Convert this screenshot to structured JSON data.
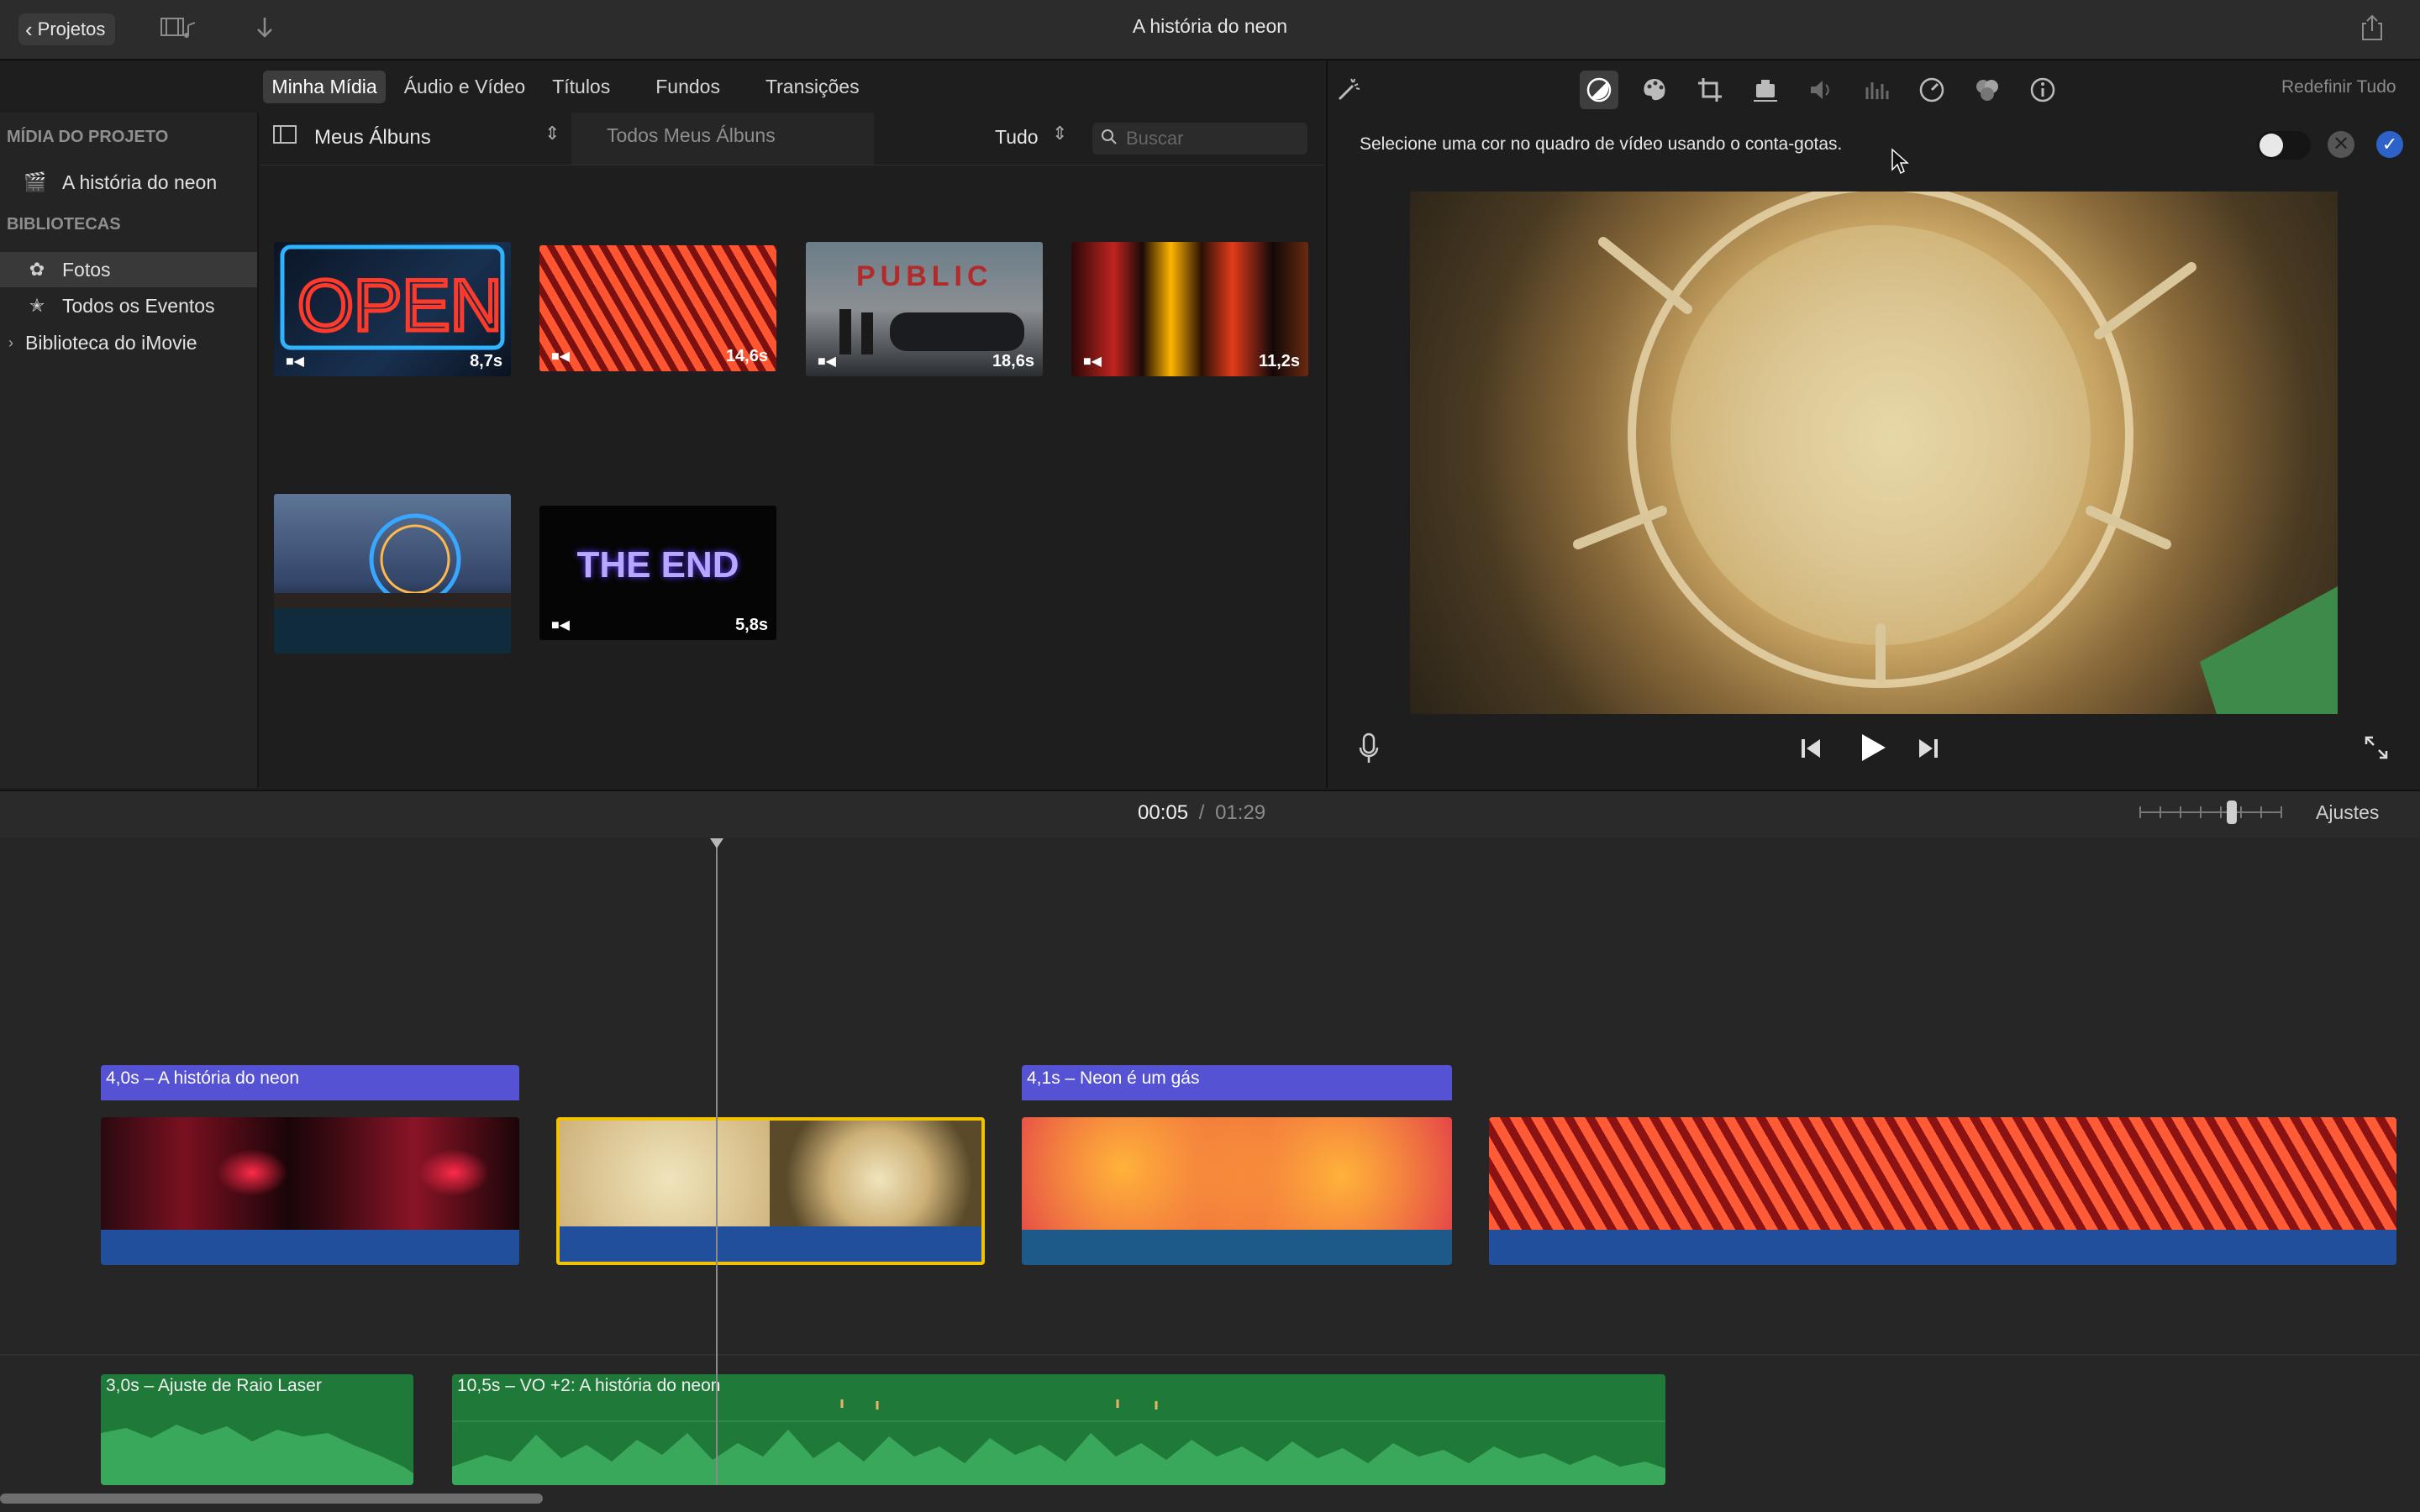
{
  "titlebar": {
    "back_label": "Projetos",
    "title": "A história do neon"
  },
  "media_tabs": [
    "Minha Mídia",
    "Áudio e Vídeo",
    "Títulos",
    "Fundos",
    "Transições"
  ],
  "sidebar": {
    "project_header": "MÍDIA DO PROJETO",
    "project_item": "A história do neon",
    "libraries_header": "BIBLIOTECAS",
    "items": [
      "Fotos",
      "Todos os Eventos"
    ],
    "library": "Biblioteca do iMovie"
  },
  "filterbar": {
    "album": "Meus Álbuns",
    "path": "Todos Meus Álbuns",
    "filter": "Tudo",
    "search_placeholder": "Buscar"
  },
  "clips": [
    {
      "name": "open",
      "duration": "8,7s"
    },
    {
      "name": "arches",
      "duration": "14,6s"
    },
    {
      "name": "market",
      "duration": "18,6s"
    },
    {
      "name": "street",
      "duration": "11,2s"
    },
    {
      "name": "ferris",
      "duration": ""
    },
    {
      "name": "the-end",
      "duration": "5,8s",
      "text": "THE END"
    }
  ],
  "viewer": {
    "reset_all": "Redefinir Tudo",
    "instruction": "Selecione uma cor no quadro de vídeo usando o conta-gotas."
  },
  "timecode": {
    "current": "00:05",
    "separator": "/",
    "total": "01:29",
    "settings": "Ajustes"
  },
  "timeline": {
    "title_clips": [
      "4,0s – A história do neon",
      "4,1s – Neon é um gás"
    ],
    "audio_clips": [
      "3,0s – Ajuste de Raio Laser",
      "10,5s – VO +2: A história do neon"
    ]
  },
  "colors": {
    "title_clip": "#5552d3",
    "audio_under": "#214f9b",
    "audio_green": "#1f7a3a",
    "selection": "#f2c200"
  }
}
